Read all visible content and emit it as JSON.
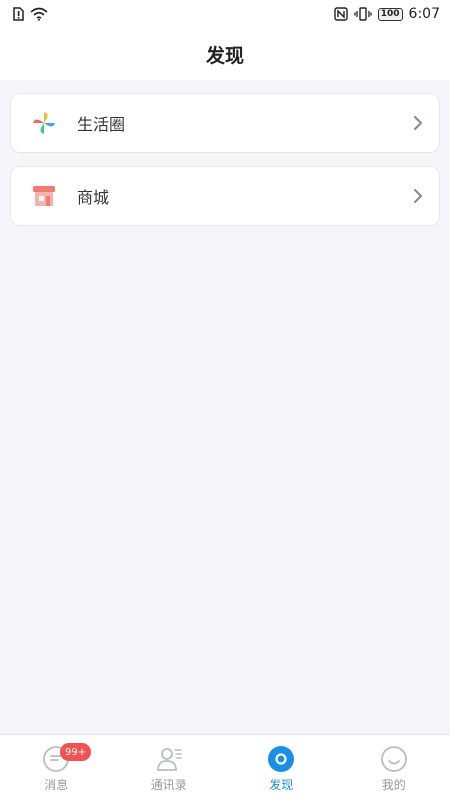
{
  "status_bar": {
    "time": "6:07",
    "battery": "100",
    "icons": [
      "alert-sim-icon",
      "wifi-icon",
      "nfc-icon",
      "vibrate-icon",
      "battery-icon"
    ]
  },
  "header": {
    "title": "发现"
  },
  "menu": {
    "items": [
      {
        "label": "生活圈",
        "icon": "pinwheel-icon"
      },
      {
        "label": "商城",
        "icon": "shop-icon"
      }
    ]
  },
  "tabbar": {
    "tabs": [
      {
        "label": "消息",
        "icon": "message-icon",
        "badge": "99+"
      },
      {
        "label": "通讯录",
        "icon": "contacts-icon"
      },
      {
        "label": "发现",
        "icon": "discover-icon",
        "active": true
      },
      {
        "label": "我的",
        "icon": "profile-icon"
      }
    ]
  },
  "colors": {
    "accent": "#1a8fe3",
    "badge": "#f25252",
    "background": "#f5f5fa"
  }
}
